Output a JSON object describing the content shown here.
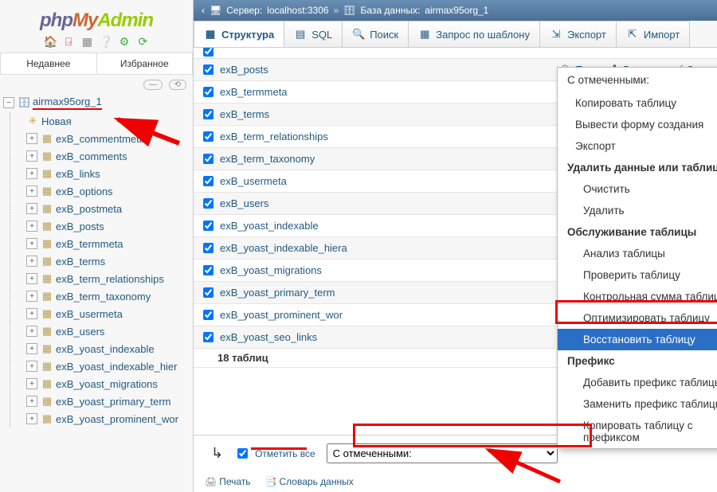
{
  "logo": {
    "p1": "php",
    "p2": "My",
    "p3": "Admin"
  },
  "recent": {
    "tab1": "Недавнее",
    "tab2": "Избранное"
  },
  "tree": {
    "db": "airmax95org_1",
    "new": "Новая",
    "tables": [
      "exB_commentmeta",
      "exB_comments",
      "exB_links",
      "exB_options",
      "exB_postmeta",
      "exB_posts",
      "exB_termmeta",
      "exB_terms",
      "exB_term_relationships",
      "exB_term_taxonomy",
      "exB_usermeta",
      "exB_users",
      "exB_yoast_indexable",
      "exB_yoast_indexable_hier",
      "exB_yoast_migrations",
      "exB_yoast_primary_term",
      "exB_yoast_prominent_wor"
    ]
  },
  "breadcrumb": {
    "server_label": "Сервер:",
    "server_val": "localhost:3306",
    "db_label": "База данных:",
    "db_val": "airmax95org_1"
  },
  "tabs": [
    "Структура",
    "SQL",
    "Поиск",
    "Запрос по шаблону",
    "Экспорт",
    "Импорт"
  ],
  "tabicons": [
    "▦",
    "▤",
    "🔍",
    "▦",
    "⇲",
    "⇱"
  ],
  "maintables": [
    "exB_posts",
    "exB_termmeta",
    "exB_terms",
    "exB_term_relationships",
    "exB_term_taxonomy",
    "exB_usermeta",
    "exB_users",
    "exB_yoast_indexable",
    "exB_yoast_indexable_hiera",
    "exB_yoast_migrations",
    "exB_yoast_primary_term",
    "exB_yoast_prominent_wor",
    "exB_yoast_seo_links"
  ],
  "actions": {
    "search": "Поиск",
    "insert": "Вставить",
    "clean": "Очис"
  },
  "summary": "18 таблиц",
  "footer": {
    "checkall": "Отметить все",
    "withsel": "С отмеченными:",
    "print": "Печать",
    "dict": "Словарь данных"
  },
  "ctx": {
    "header": "С отмеченными:",
    "copy": "Копировать таблицу",
    "form": "Вывести форму создания",
    "export": "Экспорт",
    "del_hdr": "Удалить данные или таблицу",
    "clear": "Очистить",
    "delete": "Удалить",
    "maint_hdr": "Обслуживание таблицы",
    "analyze": "Анализ таблицы",
    "check": "Проверить таблицу",
    "checksum": "Контрольная сумма таблицы",
    "optimize": "Оптимизировать таблицу",
    "repair": "Восстановить таблицу",
    "pref_hdr": "Префикс",
    "addpref": "Добавить префикс таблицы",
    "reppref": "Заменить префикс таблицы",
    "copypref": "Копировать таблицу с префиксом"
  }
}
